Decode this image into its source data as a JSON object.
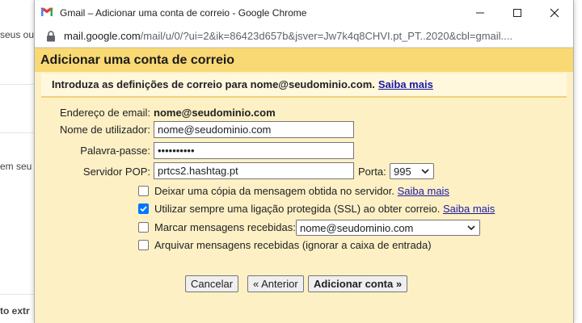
{
  "background": {
    "frag1": "seus out",
    "frag2": "em seu",
    "frag3": "to extr"
  },
  "window": {
    "title": "Gmail – Adicionar uma conta de correio - Google Chrome",
    "url_host": "mail.google.com",
    "url_rest": "/mail/u/0/?ui=2&ik=86423d657b&jsver=Jw7k4q8CHVI.pt_PT..2020&cbl=gmail...."
  },
  "dialog": {
    "title": "Adicionar uma conta de correio",
    "subhead_text": "Introduza as definições de correio para nome@seudominio.com.",
    "subhead_link": "Saiba mais",
    "email_label": "Endereço de email:",
    "email_value": "nome@seudominio.com",
    "username_label": "Nome de utilizador:",
    "username_value": "nome@seudominio.com",
    "password_label": "Palavra-passe:",
    "password_value": "••••••••••",
    "pop_label": "Servidor POP:",
    "pop_value": "prtcs2.hashtag.pt",
    "port_label": "Porta:",
    "port_value": "995",
    "options": [
      {
        "label": "Deixar uma cópia da mensagem obtida no servidor.",
        "link": "Saiba mais",
        "checked": false
      },
      {
        "label": "Utilizar sempre uma ligação protegida (SSL) ao obter correio.",
        "link": "Saiba mais",
        "checked": true
      },
      {
        "label": "Marcar mensagens recebidas:",
        "select_value": "nome@seudominio.com",
        "checked": false
      },
      {
        "label": "Arquivar mensagens recebidas (ignorar a caixa de entrada)",
        "checked": false
      }
    ],
    "buttons": {
      "cancel": "Cancelar",
      "back": "« Anterior",
      "add": "Adicionar conta »"
    }
  },
  "colors": {
    "dialog_bg": "#fdf0c4",
    "title_bg": "#f9d974",
    "link": "#1a1aa6",
    "checkbox_on": "#0075ff"
  },
  "icons": [
    "gmail-logo-icon",
    "minimize-icon",
    "maximize-icon",
    "close-icon",
    "lock-icon",
    "chevron-down-icon",
    "check-icon"
  ]
}
